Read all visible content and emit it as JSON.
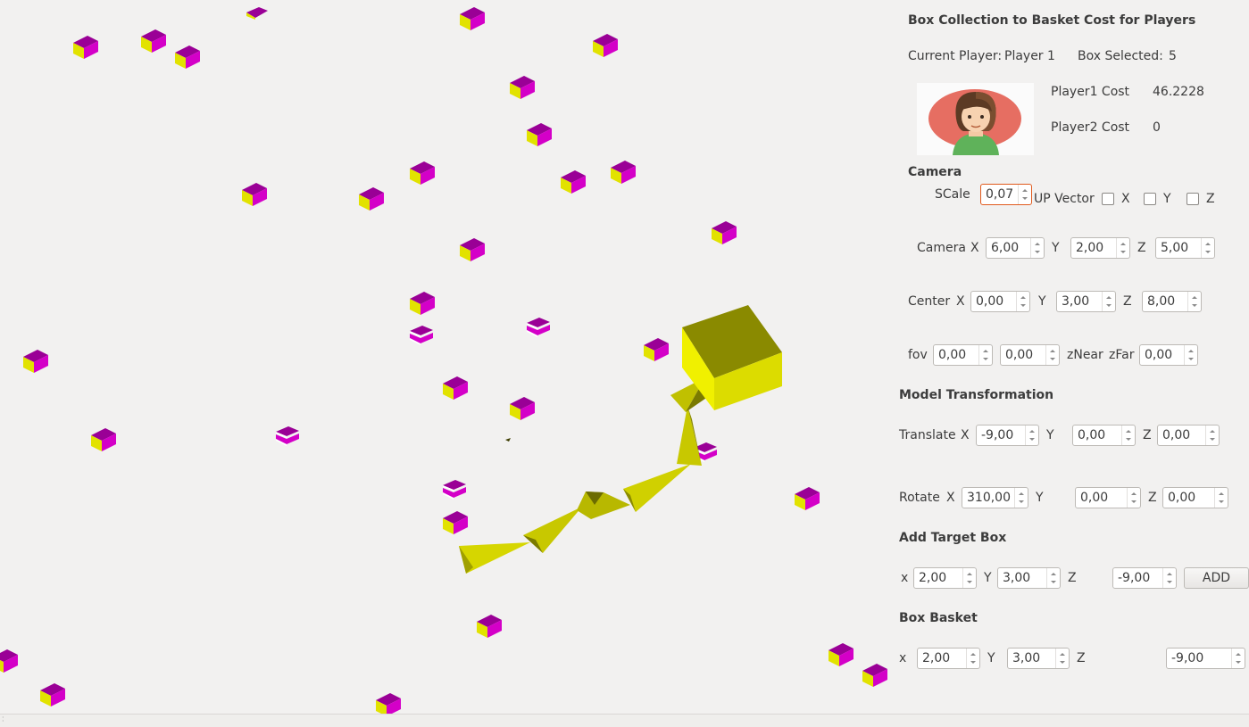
{
  "title": "Box Collection to Basket Cost for Players",
  "status": {
    "current_player_label": "Current Player:",
    "current_player": "Player 1",
    "box_selected_label": "Box Selected:",
    "box_selected": "5",
    "player1_cost_label": "Player1 Cost",
    "player1_cost": "46.2228",
    "player2_cost_label": "Player2 Cost",
    "player2_cost": "0"
  },
  "camera": {
    "heading": "Camera",
    "scale_label": "SCale",
    "scale": "0,07",
    "up_vector_label": "UP Vector",
    "up_x_label": "X",
    "up_y_label": "Y",
    "up_z_label": "Z",
    "up_x_checked": false,
    "up_y_checked": false,
    "up_z_checked": false,
    "camera_label": "Camera",
    "cam_x_label": "X",
    "cam_x": "6,00",
    "cam_y_label": "Y",
    "cam_y": "2,00",
    "cam_z_label": "Z",
    "cam_z": "5,00",
    "center_label": "Center",
    "center_x_label": "X",
    "center_x": "0,00",
    "center_y_label": "Y",
    "center_y": "3,00",
    "center_z_label": "Z",
    "center_z": "8,00",
    "fov_label": "fov",
    "fov": "0,00",
    "fov2": "0,00",
    "znear_label": "zNear",
    "zfar_label": "zFar",
    "zfar": "0,00"
  },
  "model": {
    "heading": "Model Transformation",
    "translate_label": "Translate",
    "t_x_label": "X",
    "t_x": "-9,00",
    "t_y_label": "Y",
    "t_y": "0,00",
    "t_z_label": "Z",
    "t_z": "0,00",
    "rotate_label": "Rotate",
    "r_x_label": "X",
    "r_x": "310,00",
    "r_y_label": "Y",
    "r_y": "0,00",
    "r_z_label": "Z",
    "r_z": "0,00"
  },
  "target": {
    "heading": "Add Target Box",
    "x_label": "x",
    "x": "2,00",
    "y_label": "Y",
    "y": "3,00",
    "z_label": "Z",
    "z": "-9,00",
    "add_label": "ADD"
  },
  "basket": {
    "heading": "Box Basket",
    "x_label": "x",
    "x": "2,00",
    "y_label": "Y",
    "y": "3,00",
    "z_label": "Z",
    "z": "-9,00"
  },
  "colors": {
    "box_top": "#9a0096",
    "box_side": "#d800cc",
    "box_edge": "#e6e600",
    "yellow_face": "#dcdc00",
    "yellow_dark": "#8a8a00",
    "background": "#f2f1f0"
  }
}
